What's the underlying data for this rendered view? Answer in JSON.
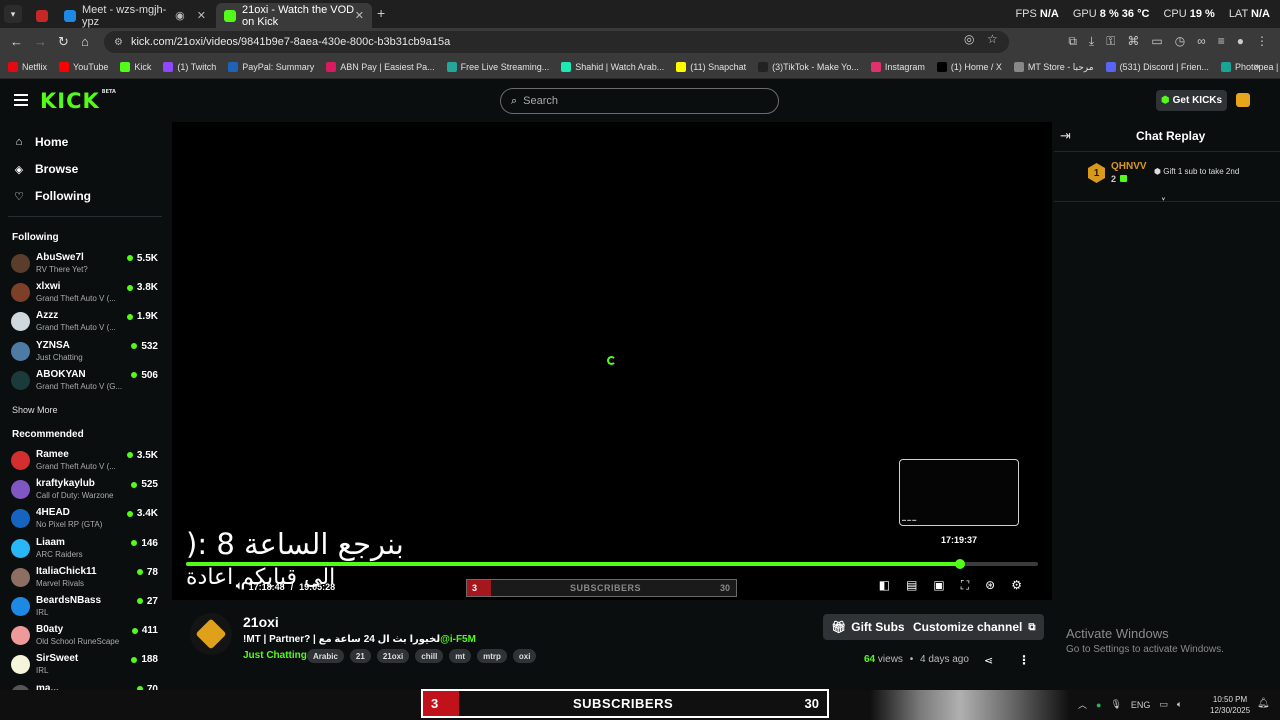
{
  "browser": {
    "tabs": [
      {
        "title": "",
        "color": "#c62828"
      },
      {
        "title": "Meet - wzs-mgjh-ypz",
        "color": "#1e88e5"
      },
      {
        "title": "21oxi - Watch the VOD on Kick",
        "color": "#53fc18"
      }
    ],
    "perf": {
      "fps_label": "FPS",
      "fps": "N/A",
      "gpu_label": "GPU",
      "gpu": "8 %",
      "gpu_temp": "36 °C",
      "cpu_label": "CPU",
      "cpu": "19 %",
      "lat_label": "LAT",
      "lat": "N/A"
    },
    "url": "kick.com/21oxi/videos/9841b9e7-8aea-430e-800c-b3b31cb9a15a",
    "bookmarks": [
      {
        "label": "Netflix",
        "color": "#e50914"
      },
      {
        "label": "YouTube",
        "color": "#ff0000"
      },
      {
        "label": "Kick",
        "color": "#53fc18"
      },
      {
        "label": "(1) Twitch",
        "color": "#9146ff"
      },
      {
        "label": "PayPal: Summary",
        "color": "#1e63b8"
      },
      {
        "label": "ABN Pay | Easiest Pa...",
        "color": "#d81b60"
      },
      {
        "label": "Free Live Streaming...",
        "color": "#26a69a"
      },
      {
        "label": "Shahid | Watch Arab...",
        "color": "#1de9b6"
      },
      {
        "label": "(11) Snapchat",
        "color": "#fffc00"
      },
      {
        "label": "(3)TikTok - Make Yo...",
        "color": "#222222"
      },
      {
        "label": "Instagram",
        "color": "#e1306c"
      },
      {
        "label": "(1) Home / X",
        "color": "#000000"
      },
      {
        "label": "MT Store - مرحبا",
        "color": "#888888"
      },
      {
        "label": "(531) Discord | Frien...",
        "color": "#5865f2"
      },
      {
        "label": "Photopea | Online P...",
        "color": "#18a497"
      }
    ]
  },
  "kick": {
    "logo": "KICK",
    "logo_badge": "BETA",
    "search_placeholder": "Search",
    "get_kicks": "Get KICKs"
  },
  "sidebar": {
    "nav": [
      {
        "label": "Home",
        "icon": "home-icon"
      },
      {
        "label": "Browse",
        "icon": "compass-icon"
      },
      {
        "label": "Following",
        "icon": "heart-icon"
      }
    ],
    "following_title": "Following",
    "following": [
      {
        "name": "AbuSwe7l",
        "category": "RV There Yet?",
        "viewers": "5.5K",
        "color": "#5a3d2b"
      },
      {
        "name": "xlxwi",
        "category": "Grand Theft Auto V (...",
        "viewers": "3.8K",
        "color": "#7b3f2a"
      },
      {
        "name": "Azzz",
        "category": "Grand Theft Auto V (...",
        "viewers": "1.9K",
        "color": "#cfd8dc"
      },
      {
        "name": "YZNSA",
        "category": "Just Chatting",
        "viewers": "532",
        "color": "#4e7ba6"
      },
      {
        "name": "ABOKYAN",
        "category": "Grand Theft Auto V (G...",
        "viewers": "506",
        "color": "#1b3a3a"
      }
    ],
    "show_more": "Show More",
    "recommended_title": "Recommended",
    "recommended": [
      {
        "name": "Ramee",
        "category": "Grand Theft Auto V (...",
        "viewers": "3.5K",
        "color": "#d32f2f"
      },
      {
        "name": "kraftykaylub",
        "category": "Call of Duty: Warzone",
        "viewers": "525",
        "color": "#7e57c2"
      },
      {
        "name": "4HEAD",
        "category": "No Pixel RP (GTA)",
        "viewers": "3.4K",
        "color": "#1565c0"
      },
      {
        "name": "Liaam",
        "category": "ARC Raiders",
        "viewers": "146",
        "color": "#29b6f6"
      },
      {
        "name": "ItaliaChick11",
        "category": "Marvel Rivals",
        "viewers": "78",
        "color": "#8d6e63"
      },
      {
        "name": "BeardsNBass",
        "category": "IRL",
        "viewers": "27",
        "color": "#1e88e5"
      },
      {
        "name": "B0aty",
        "category": "Old School RuneScape",
        "viewers": "411",
        "color": "#ef9a9a"
      },
      {
        "name": "SirSweet",
        "category": "IRL",
        "viewers": "188",
        "color": "#f5f5dc"
      },
      {
        "name": "ma...",
        "category": "",
        "viewers": "70",
        "color": "#555555"
      }
    ]
  },
  "player": {
    "overlay_text": "بنرجع الساعة 8 :(",
    "overlay_text2": "الى قبايكم اعادة",
    "thumb_time": "17:19:37",
    "current_time": "17:18:48",
    "separator": "/",
    "duration": "19:05:28",
    "progress_pct": 90.8,
    "sub_goal": {
      "count": "3",
      "label": "SUBSCRIBERS",
      "target": "30"
    }
  },
  "chat": {
    "title": "Chat Replay",
    "top_gifter": {
      "rank": "1",
      "name": "QHNVV",
      "count": "2",
      "note": "Gift 1 sub to take 2nd"
    }
  },
  "channel": {
    "name": "21oxi",
    "title": "!MT | Partner? | لخيورا بث ال 24 ساعة مع",
    "mention": "@i-F5M",
    "category": "Just Chatting",
    "tags": [
      "Arabic",
      "21",
      "21oxi",
      "chill",
      "mt",
      "mtrp",
      "oxi"
    ],
    "gift_subs": "Gift Subs",
    "customize": "Customize channel",
    "views": "64",
    "views_label": "views",
    "dot": "•",
    "age": "4 days ago"
  },
  "activate": {
    "line1": "Activate Windows",
    "line2": "Go to Settings to activate Windows."
  },
  "taskbar": {
    "sub_goal": {
      "count": "3",
      "label": "SUBSCRIBERS",
      "target": "30"
    },
    "lang": "ENG",
    "time": "10:50 PM",
    "date": "12/30/2025"
  }
}
